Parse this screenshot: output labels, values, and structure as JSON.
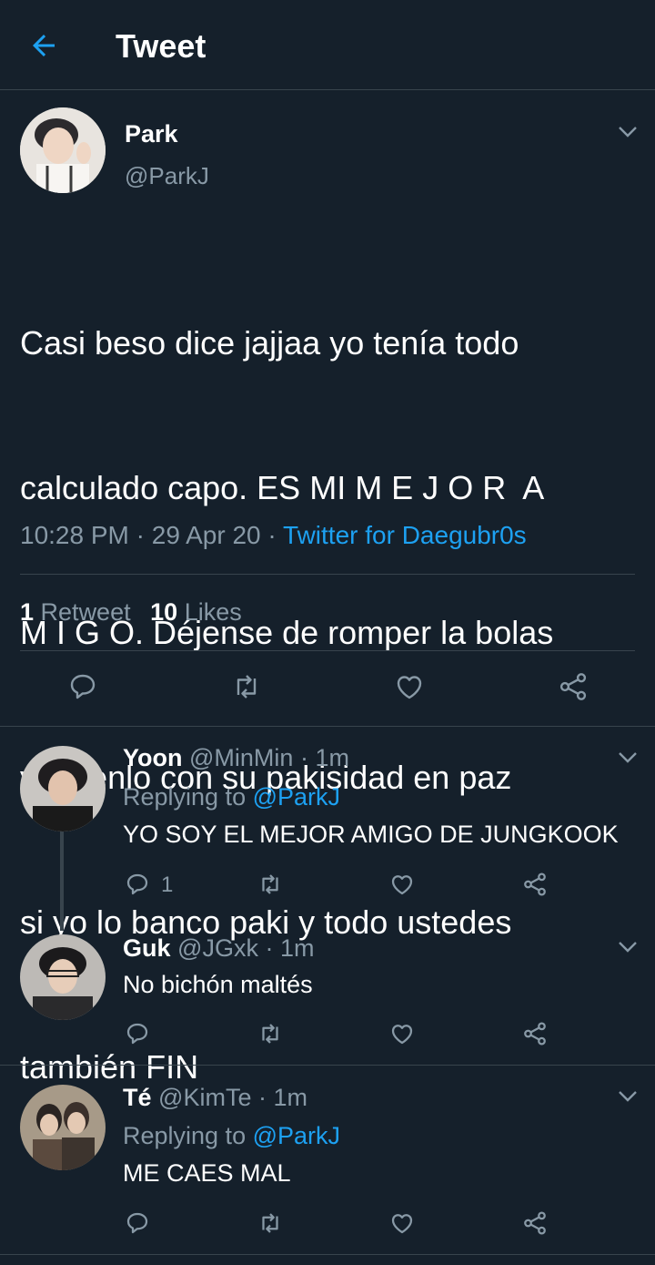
{
  "header": {
    "title": "Tweet"
  },
  "tweet": {
    "name": "Park",
    "handle": "@ParkJ",
    "text_lines": [
      "Casi beso dice jajjaa yo tenía todo",
      "calculado capo. ES MI M E J O R  A",
      "M I G O. Déjense de romper la bolas",
      "y déjenlo con su pakisidad en paz",
      "si yo lo banco paki y todo ustedes",
      "también FIN"
    ],
    "time": "10:28 PM",
    "date": "29 Apr 20",
    "source": "Twitter for Daegubr0s",
    "retweets_count": "1",
    "retweets_label": "Retweet",
    "likes_count": "10",
    "likes_label": "Likes"
  },
  "replies": [
    {
      "name": "Yoon",
      "handle": "@MinMin",
      "age": "1m",
      "replying_label": "Replying to",
      "replying_handle": "@ParkJ",
      "text": "YO SOY EL MEJOR AMIGO DE JUNGKOOK",
      "reply_count": "1"
    },
    {
      "name": "Guk",
      "handle": "@JGxk",
      "age": "1m",
      "text": "No bichón maltés"
    },
    {
      "name": "Té",
      "handle": "@KimTe",
      "age": "1m",
      "replying_label": "Replying to",
      "replying_handle": "@ParkJ",
      "text": "ME CAES MAL"
    }
  ],
  "separator": "·",
  "colors": {
    "background": "#15202b",
    "accent": "#1da1f2",
    "muted": "#8899a6",
    "divider": "#38444d"
  },
  "icons": [
    "back-arrow-icon",
    "chevron-down-icon",
    "reply-icon",
    "retweet-icon",
    "like-icon",
    "share-icon"
  ]
}
